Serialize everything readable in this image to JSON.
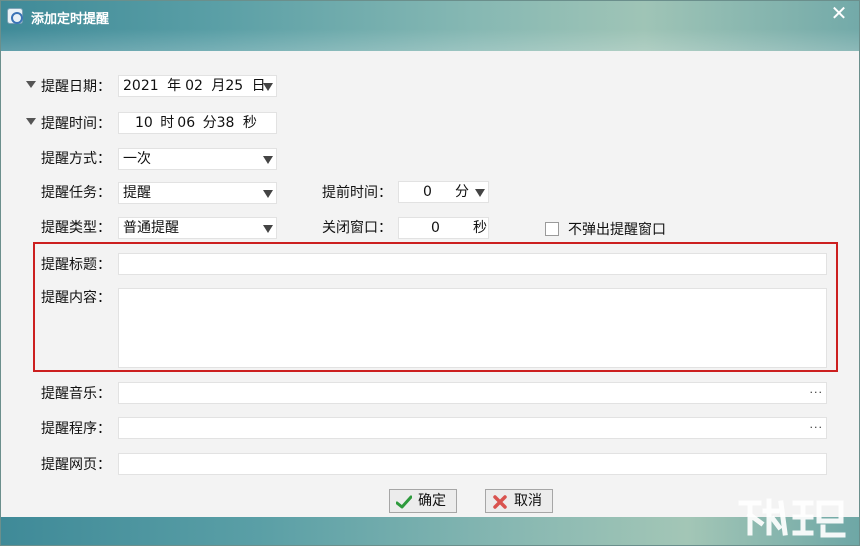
{
  "window": {
    "title": "添加定时提醒",
    "close_glyph": "✕"
  },
  "form": {
    "date": {
      "label": "提醒日期：",
      "year": "2021",
      "year_unit": "年",
      "month": "02",
      "month_unit": "月",
      "day": "25",
      "day_unit": "日"
    },
    "time": {
      "label": "提醒时间：",
      "hour": "10",
      "hour_unit": "时",
      "minute": "06",
      "minute_unit": "分",
      "second": "38",
      "second_unit": "秒"
    },
    "mode": {
      "label": "提醒方式：",
      "value": "一次"
    },
    "task": {
      "label": "提醒任务：",
      "value": "提醒"
    },
    "advance": {
      "label": "提前时间：",
      "value": "0",
      "unit": "分"
    },
    "type": {
      "label": "提醒类型：",
      "value": "普通提醒"
    },
    "close_window": {
      "label": "关闭窗口：",
      "value": "0",
      "unit": "秒"
    },
    "no_popup": {
      "label": "不弹出提醒窗口",
      "checked": false
    },
    "title_field": {
      "label": "提醒标题：",
      "value": ""
    },
    "content_field": {
      "label": "提醒内容：",
      "value": ""
    },
    "music": {
      "label": "提醒音乐：",
      "value": "",
      "browse": "···"
    },
    "program": {
      "label": "提醒程序：",
      "value": "",
      "browse": "···"
    },
    "webpage": {
      "label": "提醒网页：",
      "value": ""
    }
  },
  "buttons": {
    "ok": "确定",
    "cancel": "取消"
  },
  "colors": {
    "highlight_border": "#cc1f1f",
    "ok_icon": "#2e9a3d",
    "cancel_icon": "#d9534f"
  }
}
